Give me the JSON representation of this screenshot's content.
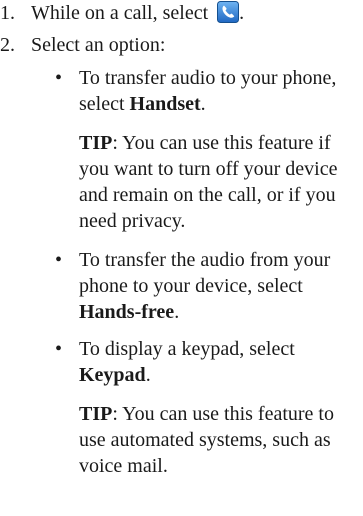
{
  "steps": [
    {
      "number": "1.",
      "text": "While on a call, select",
      "trailing": ".",
      "icon": "phone-handset-icon",
      "icon_color": "#2f7fd6"
    },
    {
      "number": "2.",
      "text": "Select an option:"
    }
  ],
  "bullet_glyph": "•",
  "options": [
    {
      "line1": "To transfer audio to your phone,",
      "prefix": "select ",
      "bold": "Handset",
      "suffix": ".",
      "tip_label": "TIP",
      "tip_lines": [
        ": You can use this feature if",
        "you want to turn off your device",
        "and remain on the call, or if you",
        "need privacy."
      ]
    },
    {
      "line1": "To transfer the audio from your",
      "line2": "phone to your device, select",
      "bold": "Hands-free",
      "suffix": "."
    },
    {
      "line1": "To display a keypad, select",
      "bold": "Keypad",
      "suffix": ".",
      "tip_label": "TIP",
      "tip_lines": [
        ": You can use this feature to",
        "use automated systems, such as",
        "voice mail."
      ]
    }
  ]
}
